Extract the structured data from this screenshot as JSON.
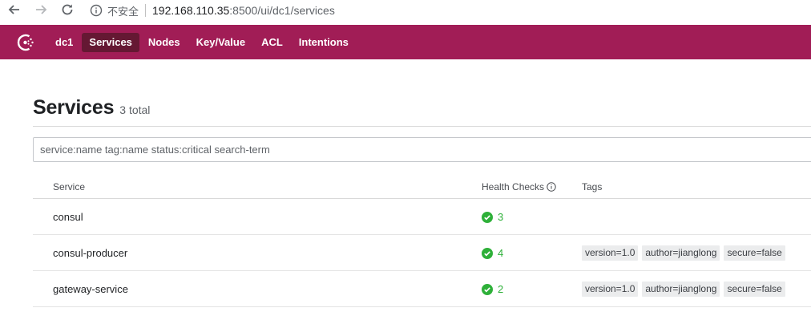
{
  "browser": {
    "insecure_label": "不安全",
    "url_host": "192.168.110.35",
    "url_rest": ":8500/ui/dc1/services",
    "icons": [
      "back-arrow-icon",
      "forward-arrow-icon",
      "reload-icon",
      "info-icon"
    ]
  },
  "topnav": {
    "accent_color": "#a11d56",
    "active_color": "#651833",
    "datacenter": "dc1",
    "items": [
      {
        "label": "Services",
        "active": true
      },
      {
        "label": "Nodes",
        "active": false
      },
      {
        "label": "Key/Value",
        "active": false
      },
      {
        "label": "ACL",
        "active": false
      },
      {
        "label": "Intentions",
        "active": false
      }
    ]
  },
  "page": {
    "title": "Services",
    "total": "3 total"
  },
  "search": {
    "placeholder": "service:name tag:name status:critical search-term",
    "value": ""
  },
  "table": {
    "headers": {
      "service": "Service",
      "health": "Health Checks",
      "tags": "Tags"
    },
    "rows": [
      {
        "service": "consul",
        "checks": "3",
        "tags": []
      },
      {
        "service": "consul-producer",
        "checks": "4",
        "tags": [
          "version=1.0",
          "author=jianglong",
          "secure=false"
        ]
      },
      {
        "service": "gateway-service",
        "checks": "2",
        "tags": [
          "version=1.0",
          "author=jianglong",
          "secure=false"
        ]
      }
    ],
    "passing_color": "#2eb039"
  }
}
